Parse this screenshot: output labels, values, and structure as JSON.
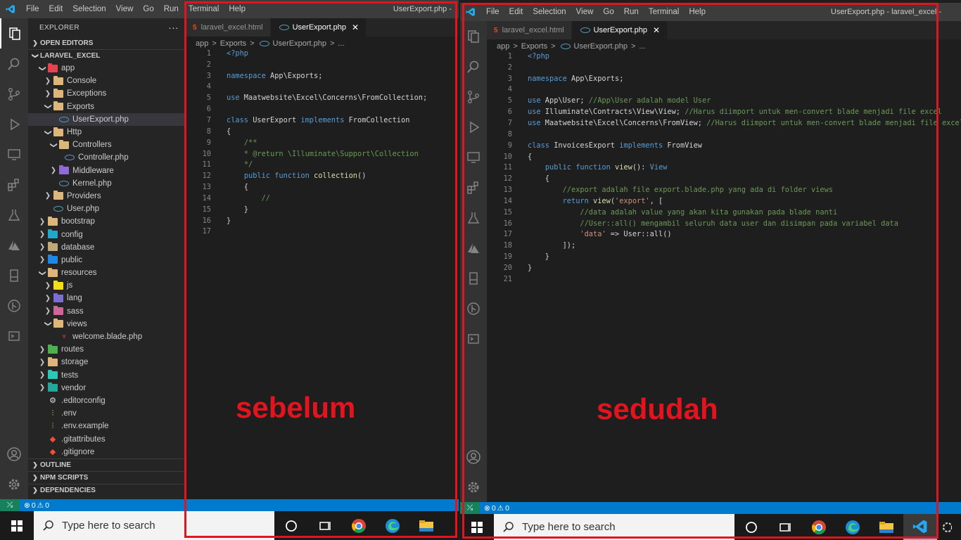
{
  "left": {
    "menu": [
      "File",
      "Edit",
      "Selection",
      "View",
      "Go",
      "Run",
      "Terminal",
      "Help"
    ],
    "window_title": "UserExport.php -",
    "explorer": {
      "title": "EXPLORER",
      "more": "···",
      "open_editors": "OPEN EDITORS",
      "project": "LARAVEL_EXCEL",
      "tree": [
        {
          "label": "app",
          "kind": "folder",
          "depth": 1,
          "open": true
        },
        {
          "label": "Console",
          "kind": "folder",
          "depth": 2,
          "open": false
        },
        {
          "label": "Exceptions",
          "kind": "folder",
          "depth": 2,
          "open": false
        },
        {
          "label": "Exports",
          "kind": "folder",
          "depth": 2,
          "open": true
        },
        {
          "label": "UserExport.php",
          "kind": "php",
          "depth": 3,
          "selected": true
        },
        {
          "label": "Http",
          "kind": "folder",
          "depth": 2,
          "open": true
        },
        {
          "label": "Controllers",
          "kind": "folder",
          "depth": 3,
          "open": true
        },
        {
          "label": "Controller.php",
          "kind": "php",
          "depth": 4
        },
        {
          "label": "Middleware",
          "kind": "folder",
          "depth": 3,
          "open": false
        },
        {
          "label": "Kernel.php",
          "kind": "php",
          "depth": 3
        },
        {
          "label": "Providers",
          "kind": "folder",
          "depth": 2,
          "open": false
        },
        {
          "label": "User.php",
          "kind": "php",
          "depth": 2
        },
        {
          "label": "bootstrap",
          "kind": "folder",
          "depth": 1,
          "open": false
        },
        {
          "label": "config",
          "kind": "folder",
          "depth": 1,
          "open": false
        },
        {
          "label": "database",
          "kind": "folder",
          "depth": 1,
          "open": false
        },
        {
          "label": "public",
          "kind": "folder",
          "depth": 1,
          "open": false
        },
        {
          "label": "resources",
          "kind": "folder",
          "depth": 1,
          "open": true
        },
        {
          "label": "js",
          "kind": "folder",
          "depth": 2,
          "open": false
        },
        {
          "label": "lang",
          "kind": "folder",
          "depth": 2,
          "open": false
        },
        {
          "label": "sass",
          "kind": "folder",
          "depth": 2,
          "open": false
        },
        {
          "label": "views",
          "kind": "folder",
          "depth": 2,
          "open": true
        },
        {
          "label": "welcome.blade.php",
          "kind": "blade",
          "depth": 3
        },
        {
          "label": "routes",
          "kind": "folder",
          "depth": 1,
          "open": false
        },
        {
          "label": "storage",
          "kind": "folder",
          "depth": 1,
          "open": false
        },
        {
          "label": "tests",
          "kind": "folder",
          "depth": 1,
          "open": false
        },
        {
          "label": "vendor",
          "kind": "folder",
          "depth": 1,
          "open": false
        },
        {
          "label": ".editorconfig",
          "kind": "file",
          "depth": 1
        },
        {
          "label": ".env",
          "kind": "env",
          "depth": 1
        },
        {
          "label": ".env.example",
          "kind": "env",
          "depth": 1
        },
        {
          "label": ".gitattributes",
          "kind": "git",
          "depth": 1
        },
        {
          "label": ".gitignore",
          "kind": "git",
          "depth": 1
        }
      ],
      "outline": "OUTLINE",
      "npm": "NPM SCRIPTS",
      "deps": "DEPENDENCIES"
    },
    "tabs": [
      {
        "label": "laravel_excel.html",
        "active": false
      },
      {
        "label": "UserExport.php",
        "active": true
      }
    ],
    "breadcrumb": [
      "app",
      ">",
      "Exports",
      ">",
      "UserExport.php",
      ">",
      "..."
    ],
    "code": [
      [
        [
          "kw",
          "<?php"
        ]
      ],
      [],
      [
        [
          "kw",
          "namespace"
        ],
        [
          "tx",
          " App\\Exports;"
        ]
      ],
      [],
      [
        [
          "kw",
          "use"
        ],
        [
          "tx",
          " Maatwebsite\\Excel\\Concerns\\FromCollection;"
        ]
      ],
      [],
      [
        [
          "kw",
          "class"
        ],
        [
          "tx",
          " UserExport "
        ],
        [
          "kw",
          "implements"
        ],
        [
          "tx",
          " FromCollection"
        ]
      ],
      [
        [
          "tx",
          "{"
        ]
      ],
      [
        [
          "tx",
          "    "
        ],
        [
          "cm",
          "/**"
        ]
      ],
      [
        [
          "tx",
          "    "
        ],
        [
          "cm",
          "* @return \\Illuminate\\Support\\Collection"
        ]
      ],
      [
        [
          "tx",
          "    "
        ],
        [
          "cm",
          "*/"
        ]
      ],
      [
        [
          "tx",
          "    "
        ],
        [
          "kw",
          "public function"
        ],
        [
          "fn",
          " collection"
        ],
        [
          "tx",
          "()"
        ]
      ],
      [
        [
          "tx",
          "    {"
        ]
      ],
      [
        [
          "tx",
          "        "
        ],
        [
          "cm",
          "//"
        ]
      ],
      [
        [
          "tx",
          "    }"
        ]
      ],
      [
        [
          "tx",
          "}"
        ]
      ],
      []
    ],
    "status": {
      "errors": "0",
      "warnings": "0"
    },
    "taskbar": {
      "search": "Type here to search"
    },
    "label": "sebelum"
  },
  "right": {
    "menu": [
      "File",
      "Edit",
      "Selection",
      "View",
      "Go",
      "Run",
      "Terminal",
      "Help"
    ],
    "window_title": "UserExport.php - laravel_excel -",
    "tabs": [
      {
        "label": "laravel_excel.html",
        "active": false
      },
      {
        "label": "UserExport.php",
        "active": true
      }
    ],
    "breadcrumb": [
      "app",
      ">",
      "Exports",
      ">",
      "UserExport.php",
      ">",
      "..."
    ],
    "code": [
      [
        [
          "kw",
          "<?php"
        ]
      ],
      [],
      [
        [
          "kw",
          "namespace"
        ],
        [
          "tx",
          " App\\Exports;"
        ]
      ],
      [],
      [
        [
          "kw",
          "use"
        ],
        [
          "tx",
          " App\\User; "
        ],
        [
          "cm",
          "//App\\User adalah model User"
        ]
      ],
      [
        [
          "kw",
          "use"
        ],
        [
          "tx",
          " Illuminate\\Contracts\\View\\View; "
        ],
        [
          "cm",
          "//Harus diimport untuk men-convert blade menjadi file excel"
        ]
      ],
      [
        [
          "kw",
          "use"
        ],
        [
          "tx",
          " Maatwebsite\\Excel\\Concerns\\FromView; "
        ],
        [
          "cm",
          "//Harus diimport untuk men-convert blade menjadi file excel"
        ]
      ],
      [],
      [
        [
          "kw",
          "class"
        ],
        [
          "tx",
          " InvoicesExport "
        ],
        [
          "kw",
          "implements"
        ],
        [
          "tx",
          " FromView"
        ]
      ],
      [
        [
          "tx",
          "{"
        ]
      ],
      [
        [
          "tx",
          "    "
        ],
        [
          "kw",
          "public function"
        ],
        [
          "fn",
          " view"
        ],
        [
          "tx",
          "(): "
        ],
        [
          "kw",
          "View"
        ]
      ],
      [
        [
          "tx",
          "    {"
        ]
      ],
      [
        [
          "tx",
          "        "
        ],
        [
          "cm",
          "//export adalah file export.blade.php yang ada di folder views"
        ]
      ],
      [
        [
          "tx",
          "        "
        ],
        [
          "kw",
          "return"
        ],
        [
          "fn",
          " view"
        ],
        [
          "tx",
          "("
        ],
        [
          "str",
          "'export'"
        ],
        [
          "tx",
          ", ["
        ]
      ],
      [
        [
          "tx",
          "            "
        ],
        [
          "cm",
          "//data adalah value yang akan kita gunakan pada blade nanti"
        ]
      ],
      [
        [
          "tx",
          "            "
        ],
        [
          "cm",
          "//User::all() mengambil seluruh data user dan disimpan pada variabel data"
        ]
      ],
      [
        [
          "tx",
          "            "
        ],
        [
          "str",
          "'data'"
        ],
        [
          "tx",
          " => User::all()"
        ]
      ],
      [
        [
          "tx",
          "        ]);"
        ]
      ],
      [
        [
          "tx",
          "    }"
        ]
      ],
      [
        [
          "tx",
          "}"
        ]
      ],
      []
    ],
    "status": {
      "errors": "0",
      "warnings": "0"
    },
    "taskbar": {
      "search": "Type here to search"
    },
    "label": "sedudah"
  },
  "colors": {
    "accent": "#007acc",
    "annotation": "#e3141d",
    "folder": "#dcb67a",
    "php": "#519aba"
  }
}
